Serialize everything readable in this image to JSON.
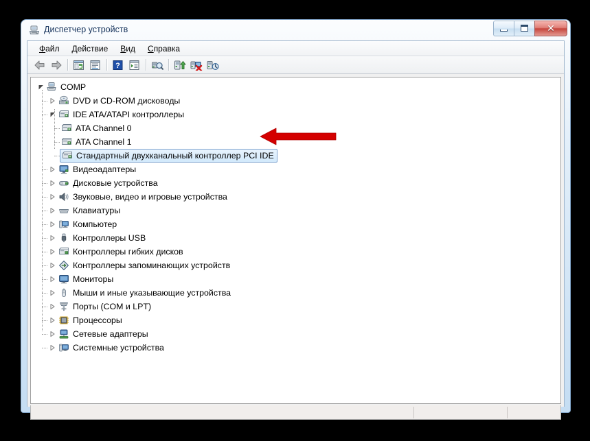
{
  "window": {
    "title": "Диспетчер устройств",
    "icon": "device-manager-icon",
    "controls": {
      "minimize": "Свернуть",
      "maximize": "Развернуть",
      "close": "Закрыть",
      "close_glyph": "✕"
    }
  },
  "menubar": {
    "items": [
      {
        "name": "menu-file",
        "accel": "Ф",
        "rest": "айл"
      },
      {
        "name": "menu-action",
        "accel": "Д",
        "rest": "ействие"
      },
      {
        "name": "menu-view",
        "accel": "В",
        "rest": "ид"
      },
      {
        "name": "menu-help",
        "accel": "С",
        "rest": "правка"
      }
    ]
  },
  "toolbar": {
    "buttons": [
      {
        "name": "back-button",
        "icon": "back-arrow-icon"
      },
      {
        "name": "forward-button",
        "icon": "forward-arrow-icon"
      },
      {
        "name": "show-console-tree-button",
        "icon": "console-tree-icon"
      },
      {
        "name": "properties-button",
        "icon": "properties-icon"
      },
      {
        "name": "help-button",
        "icon": "help-question-icon"
      },
      {
        "name": "show-details-button",
        "icon": "details-pane-icon"
      },
      {
        "name": "scan-hardware-button",
        "icon": "scan-magnifier-icon"
      },
      {
        "name": "update-driver-button",
        "icon": "update-driver-icon"
      },
      {
        "name": "uninstall-device-button",
        "icon": "uninstall-red-x-icon"
      },
      {
        "name": "disable-device-button",
        "icon": "disable-device-icon"
      }
    ]
  },
  "tree": {
    "root": {
      "label": "COMP",
      "icon": "computer-root-icon",
      "expanded": true
    },
    "nodes": [
      {
        "label": "DVD и CD-ROM дисководы",
        "icon": "dvd-drive-icon",
        "level": 1,
        "state": "collapsed"
      },
      {
        "label": "IDE ATA/ATAPI контроллеры",
        "icon": "ide-controller-icon",
        "level": 1,
        "state": "expanded"
      },
      {
        "label": "ATA Channel 0",
        "icon": "ide-controller-icon",
        "level": 2,
        "state": "leaf"
      },
      {
        "label": "ATA Channel 1",
        "icon": "ide-controller-icon",
        "level": 2,
        "state": "leaf"
      },
      {
        "label": "Стандартный двухканальный контроллер PCI IDE",
        "icon": "ide-controller-icon",
        "level": 2,
        "state": "leaf",
        "selected": true
      },
      {
        "label": "Видеоадаптеры",
        "icon": "display-adapter-icon",
        "level": 1,
        "state": "collapsed"
      },
      {
        "label": "Дисковые устройства",
        "icon": "disk-drive-icon",
        "level": 1,
        "state": "collapsed"
      },
      {
        "label": "Звуковые, видео и игровые устройства",
        "icon": "sound-device-icon",
        "level": 1,
        "state": "collapsed"
      },
      {
        "label": "Клавиатуры",
        "icon": "keyboard-icon",
        "level": 1,
        "state": "collapsed"
      },
      {
        "label": "Компьютер",
        "icon": "computer-icon",
        "level": 1,
        "state": "collapsed"
      },
      {
        "label": "Контроллеры USB",
        "icon": "usb-icon",
        "level": 1,
        "state": "collapsed"
      },
      {
        "label": "Контроллеры гибких дисков",
        "icon": "floppy-controller-icon",
        "level": 1,
        "state": "collapsed"
      },
      {
        "label": "Контроллеры запоминающих устройств",
        "icon": "storage-controller-icon",
        "level": 1,
        "state": "collapsed"
      },
      {
        "label": "Мониторы",
        "icon": "monitor-icon",
        "level": 1,
        "state": "collapsed"
      },
      {
        "label": "Мыши и иные указывающие устройства",
        "icon": "mouse-icon",
        "level": 1,
        "state": "collapsed"
      },
      {
        "label": "Порты (COM и LPT)",
        "icon": "port-icon",
        "level": 1,
        "state": "collapsed"
      },
      {
        "label": "Процессоры",
        "icon": "processor-icon",
        "level": 1,
        "state": "collapsed"
      },
      {
        "label": "Сетевые адаптеры",
        "icon": "network-adapter-icon",
        "level": 1,
        "state": "collapsed"
      },
      {
        "label": "Системные устройства",
        "icon": "system-device-icon",
        "level": 1,
        "state": "collapsed"
      }
    ]
  },
  "annotation": {
    "name": "red-callout-arrow",
    "points_to": "Стандартный двухканальный контроллер PCI IDE",
    "color": "#d40000",
    "direction": "left"
  },
  "statusbar": {
    "text": "",
    "panel2": "",
    "panel3": ""
  },
  "colors": {
    "selection_fill": "#d9ecfb",
    "selection_border": "#7da2ce",
    "window_glass": "#cddff1",
    "desktop": "#000000"
  }
}
